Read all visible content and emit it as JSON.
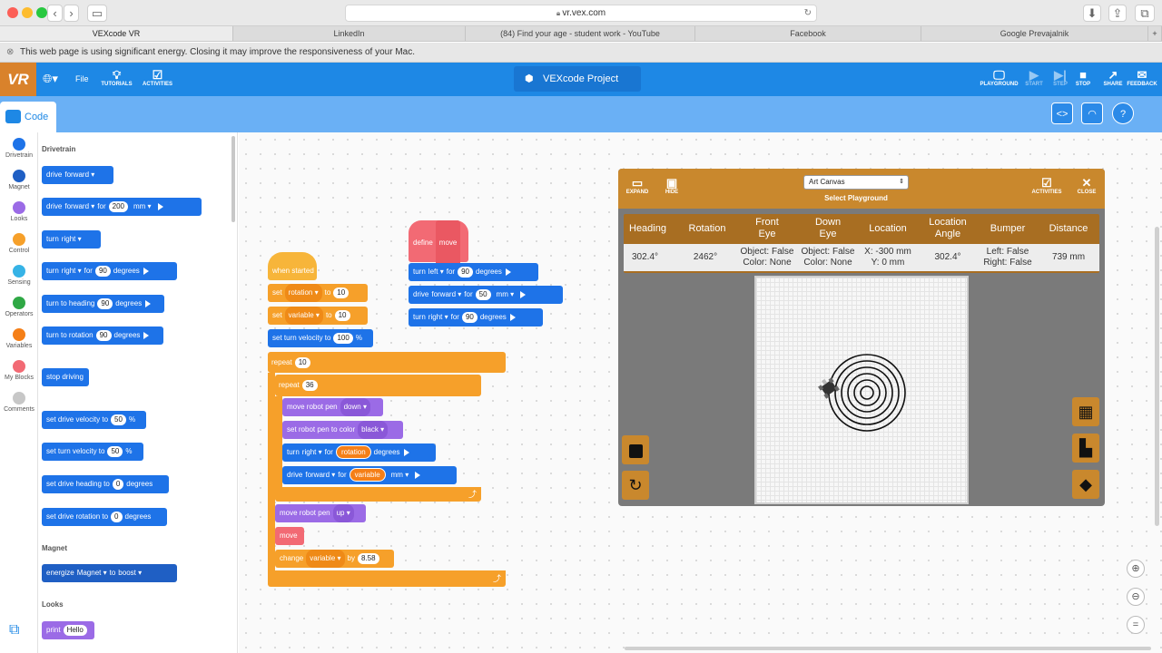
{
  "browser": {
    "url": "vr.vex.com",
    "tabs": [
      "VEXcode VR",
      "LinkedIn",
      "(84) Find your age - student work - YouTube",
      "Facebook",
      "Google Prevajalnik"
    ],
    "notice": "This web page is using significant energy. Closing it may improve the responsiveness of your Mac."
  },
  "header": {
    "logo": "VR",
    "file": "File",
    "tutorials": "TUTORIALS",
    "activities": "ACTIVITIES",
    "project_title": "VEXcode Project",
    "playground": "PLAYGROUND",
    "start": "START",
    "step": "STEP",
    "stop": "STOP",
    "share": "SHARE",
    "feedback": "FEEDBACK"
  },
  "codebar": {
    "tab": "Code"
  },
  "categories": [
    {
      "label": "Drivetrain",
      "color": "#1e73e8"
    },
    {
      "label": "Magnet",
      "color": "#1f5fc4"
    },
    {
      "label": "Looks",
      "color": "#9b6be6"
    },
    {
      "label": "Control",
      "color": "#f6a02a"
    },
    {
      "label": "Sensing",
      "color": "#36b3e6"
    },
    {
      "label": "Operators",
      "color": "#2fa845"
    },
    {
      "label": "Variables",
      "color": "#f57f17"
    },
    {
      "label": "My Blocks",
      "color": "#f26a74"
    },
    {
      "label": "Comments",
      "color": "#c7c7c7"
    }
  ],
  "palette": {
    "drivetrain_title": "Drivetrain",
    "magnet_title": "Magnet",
    "looks_title": "Looks",
    "drive": "drive",
    "forward": "forward",
    "for": "for",
    "mm": "mm",
    "v200": "200",
    "turn": "turn",
    "right": "right",
    "degrees": "degrees",
    "v90": "90",
    "turn_to_heading": "turn to heading",
    "turn_to_rotation": "turn to rotation",
    "stop_driving": "stop driving",
    "set_drive_velocity_to": "set drive velocity to",
    "set_turn_velocity_to": "set turn velocity to",
    "v50": "50",
    "percent": "%",
    "set_drive_heading_to": "set drive heading to",
    "set_drive_rotation_to": "set drive rotation to",
    "v0": "0",
    "energize": "energize",
    "magnet": "Magnet",
    "to": "to",
    "boost": "boost",
    "print": "print",
    "hello": "Hello"
  },
  "script": {
    "when_started": "when started",
    "set": "set",
    "rotation": "rotation",
    "variable": "variable",
    "to": "to",
    "v10": "10",
    "set_turn_velocity_to": "set turn velocity to",
    "v100": "100",
    "percent": "%",
    "repeat": "repeat",
    "v36": "36",
    "move_robot_pen": "move robot pen",
    "down": "down",
    "up": "up",
    "set_robot_pen_to_color": "set robot pen to color",
    "black": "black",
    "turn": "turn",
    "right": "right",
    "left": "left",
    "for": "for",
    "degrees": "degrees",
    "drive": "drive",
    "forward": "forward",
    "mm": "mm",
    "move": "move",
    "change": "change",
    "by": "by",
    "v858": "8.58",
    "define": "define",
    "v90": "90",
    "v50": "50"
  },
  "playground": {
    "expand": "EXPAND",
    "hide": "HIDE",
    "select_value": "Art Canvas",
    "select_label": "Select Playground",
    "activities": "ACTIVITIES",
    "close": "CLOSE",
    "headers": [
      "Heading",
      "Rotation",
      "Front\nEye",
      "Down\nEye",
      "Location",
      "Location\nAngle",
      "Bumper",
      "Distance"
    ],
    "values": [
      "302.4°",
      "2462°",
      "Object: False\nColor: None",
      "Object: False\nColor: None",
      "X: -300 mm\nY: 0 mm",
      "302.4°",
      "Left: False\nRight: False",
      "739 mm"
    ]
  }
}
